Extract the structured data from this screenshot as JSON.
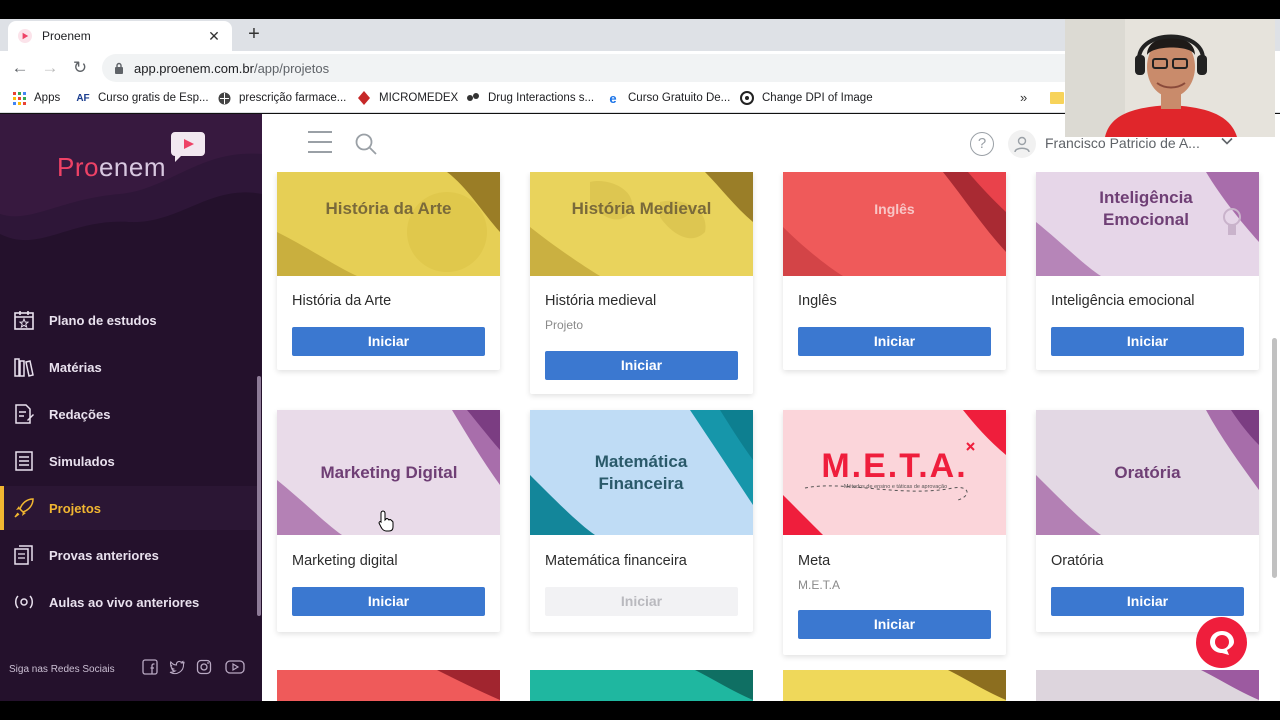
{
  "browser": {
    "tab_title": "Proenem",
    "url_main": "app.proenem.com.br",
    "url_path": "/app/projetos",
    "bookmarks": [
      {
        "label": "Apps",
        "icon": "apps-grid-icon"
      },
      {
        "label": "Curso gratis de Esp...",
        "icon": "af-icon"
      },
      {
        "label": "prescrição farmace...",
        "icon": "globe-icon"
      },
      {
        "label": "MICROMEDEX",
        "icon": "micromedex-icon"
      },
      {
        "label": "Drug Interactions s...",
        "icon": "drug-icon"
      },
      {
        "label": "Curso Gratuito De...",
        "icon": "e-icon"
      },
      {
        "label": "Change DPI of Image",
        "icon": "dpi-icon"
      }
    ],
    "bookmarks_more": "»"
  },
  "sidebar": {
    "logo_pro": "Pro",
    "logo_enem": "enem",
    "items": [
      {
        "label": "Plano de estudos",
        "icon": "calendar-star-icon"
      },
      {
        "label": "Matérias",
        "icon": "books-icon"
      },
      {
        "label": "Redações",
        "icon": "document-pencil-icon"
      },
      {
        "label": "Simulados",
        "icon": "checklist-icon"
      },
      {
        "label": "Projetos",
        "icon": "rocket-icon",
        "active": true
      },
      {
        "label": "Provas anteriores",
        "icon": "exams-icon"
      },
      {
        "label": "Aulas ao vivo anteriores",
        "icon": "live-icon"
      }
    ],
    "social_label": "Siga nas Redes Sociais"
  },
  "header": {
    "user_name": "Francisco Patricio de A..."
  },
  "cards": [
    {
      "image_text": "História da Arte",
      "title": "História da Arte",
      "subtitle": "",
      "button": "Iniciar",
      "enabled": true,
      "theme": "yellow"
    },
    {
      "image_text": "História Medieval",
      "title": "História medieval",
      "subtitle": "Projeto",
      "button": "Iniciar",
      "enabled": true,
      "theme": "yellow"
    },
    {
      "image_text": "Inglês",
      "title": "Inglês",
      "subtitle": "",
      "button": "Iniciar",
      "enabled": true,
      "theme": "red"
    },
    {
      "image_text": "Inteligência Emocional",
      "title": "Inteligência emocional",
      "subtitle": "",
      "button": "Iniciar",
      "enabled": true,
      "theme": "purple"
    },
    {
      "image_text": "Marketing Digital",
      "title": "Marketing digital",
      "subtitle": "",
      "button": "Iniciar",
      "enabled": true,
      "theme": "purple"
    },
    {
      "image_text": "Matemática Financeira",
      "title": "Matemática financeira",
      "subtitle": "",
      "button": "Iniciar",
      "enabled": false,
      "theme": "blue"
    },
    {
      "image_text": "M.E.T.A.",
      "image_subtext": "Métodos de ensino e táticas de aprovação",
      "title": "Meta",
      "subtitle": "M.E.T.A",
      "button": "Iniciar",
      "enabled": true,
      "theme": "pink"
    },
    {
      "image_text": "Oratória",
      "title": "Oratória",
      "subtitle": "",
      "button": "Iniciar",
      "enabled": true,
      "theme": "purple"
    }
  ],
  "colors": {
    "sidebar_bg": "#24112c",
    "active_accent": "#f1b631",
    "button_blue": "#3b78d0",
    "chat_red": "#ef1e3c",
    "logo_pink": "#ee4266"
  }
}
